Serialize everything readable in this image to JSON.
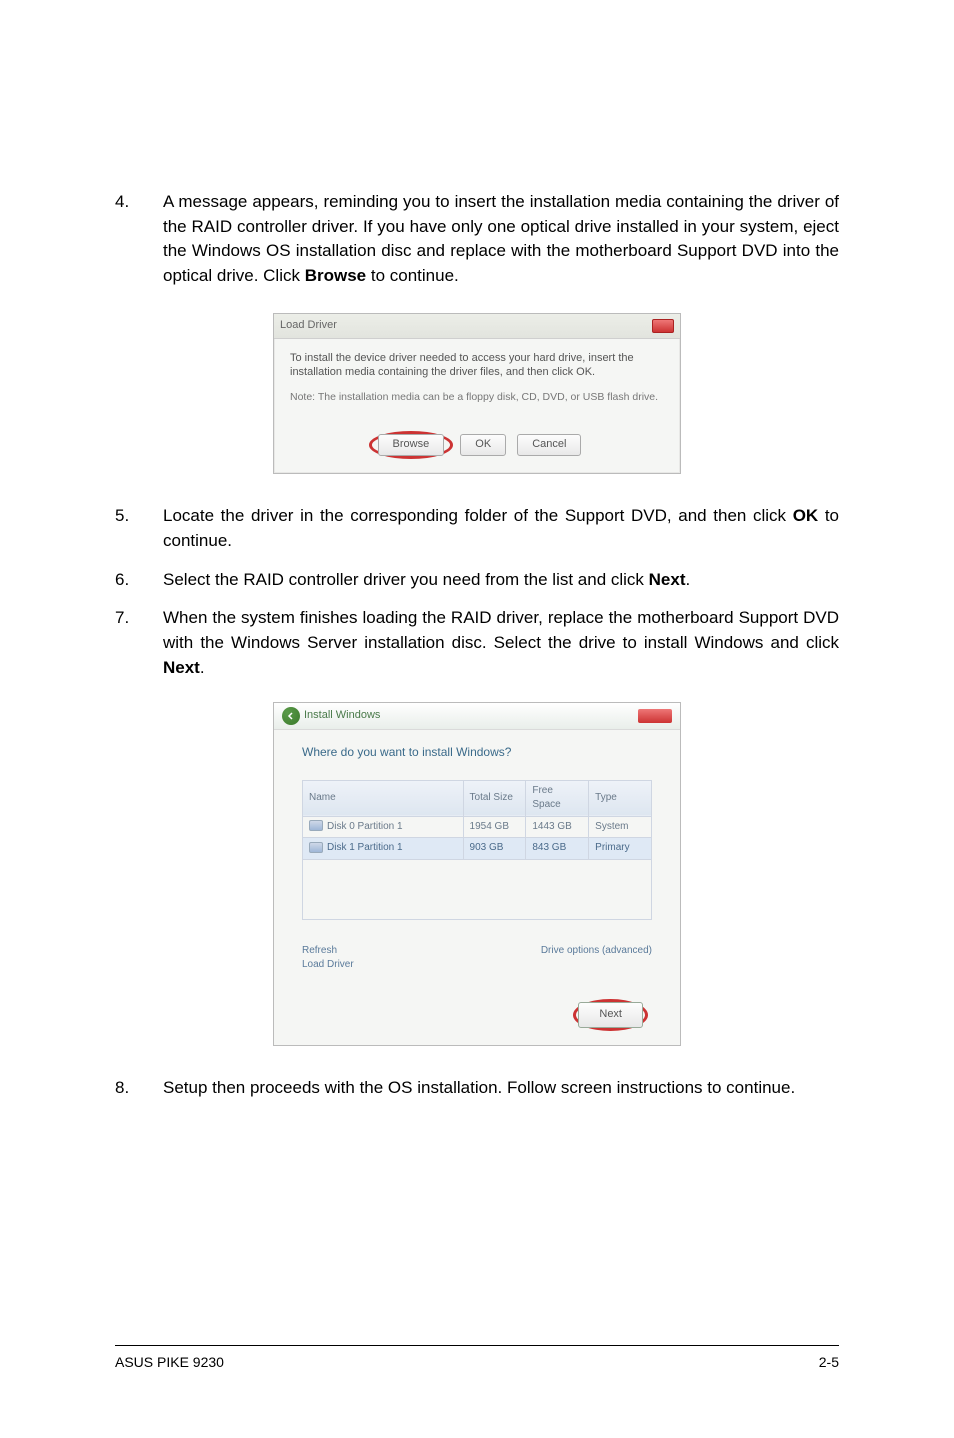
{
  "steps": {
    "s4": {
      "num": "4.",
      "text_a": "A message appears, reminding you to insert the installation media containing the driver of the RAID controller driver. If you have only one optical drive installed in your system, eject the Windows OS installation disc and replace with the motherboard Support DVD into the optical drive. Click ",
      "bold": "Browse",
      "text_b": " to continue."
    },
    "s5": {
      "num": "5.",
      "text_a": "Locate the driver in the corresponding folder of the Support DVD, and then click ",
      "bold": "OK",
      "text_b": " to continue."
    },
    "s6": {
      "num": "6.",
      "text_a": "Select the RAID controller driver you need from the list and click ",
      "bold": "Next",
      "text_b": "."
    },
    "s7": {
      "num": "7.",
      "text_a": "When the system finishes loading the RAID driver, replace the motherboard Support DVD with the Windows Server installation disc. Select the drive to install Windows and click ",
      "bold": "Next",
      "text_b": "."
    },
    "s8": {
      "num": "8.",
      "text_a": "Setup then proceeds with the OS installation. Follow screen instructions to continue."
    }
  },
  "dialog1": {
    "title": "Load Driver",
    "msg": "To install the device driver needed to access your hard drive, insert the installation media containing the driver files, and then click OK.",
    "note": "Note: The installation media can be a floppy disk, CD, DVD, or USB flash drive.",
    "browse": "Browse",
    "ok": "OK",
    "cancel": "Cancel"
  },
  "dialog2": {
    "navtitle": "Install Windows",
    "question": "Where do you want to install Windows?",
    "headers": {
      "name": "Name",
      "total": "Total Size",
      "free": "Free Space",
      "type": "Type"
    },
    "rows": [
      {
        "name": "Disk 0 Partition 1",
        "total": "1954 GB",
        "free": "1443 GB",
        "type": "System"
      },
      {
        "name": "Disk 1 Partition 1",
        "total": "903 GB",
        "free": "843 GB",
        "type": "Primary"
      }
    ],
    "refresh": "Refresh",
    "load": "Load Driver",
    "driveopts": "Drive options (advanced)",
    "next": "Next"
  },
  "footer": {
    "left": "ASUS PIKE 9230",
    "right": "2-5"
  }
}
